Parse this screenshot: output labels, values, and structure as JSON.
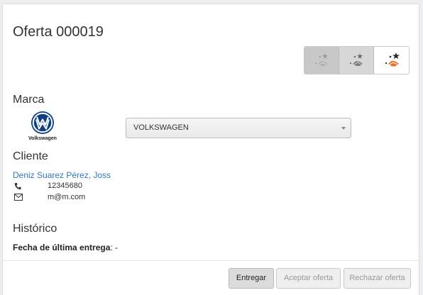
{
  "offer": {
    "title": "Oferta 000019"
  },
  "stages": [
    {
      "icon": "handshake-stars-icon",
      "state": "inactive"
    },
    {
      "icon": "handshake-stars-icon",
      "state": "inactive"
    },
    {
      "icon": "handshake-stars-icon",
      "state": "active"
    }
  ],
  "brand": {
    "label": "Marca",
    "logo_text": "Volkswagen",
    "selected": "VOLKSWAGEN"
  },
  "client": {
    "label": "Cliente",
    "name": "Deniz Suarez Pérez, Joss",
    "phone": "12345680",
    "email": "m@m.com"
  },
  "history": {
    "label": "Histórico",
    "last_delivery_label": "Fecha de última entrega",
    "last_delivery_value": ": -"
  },
  "actions": {
    "deliver": "Entregar",
    "accept": "Aceptar oferta",
    "reject": "Rechazar oferta"
  },
  "colors": {
    "link": "#3377bb",
    "accent_orange": "#e8702a"
  }
}
